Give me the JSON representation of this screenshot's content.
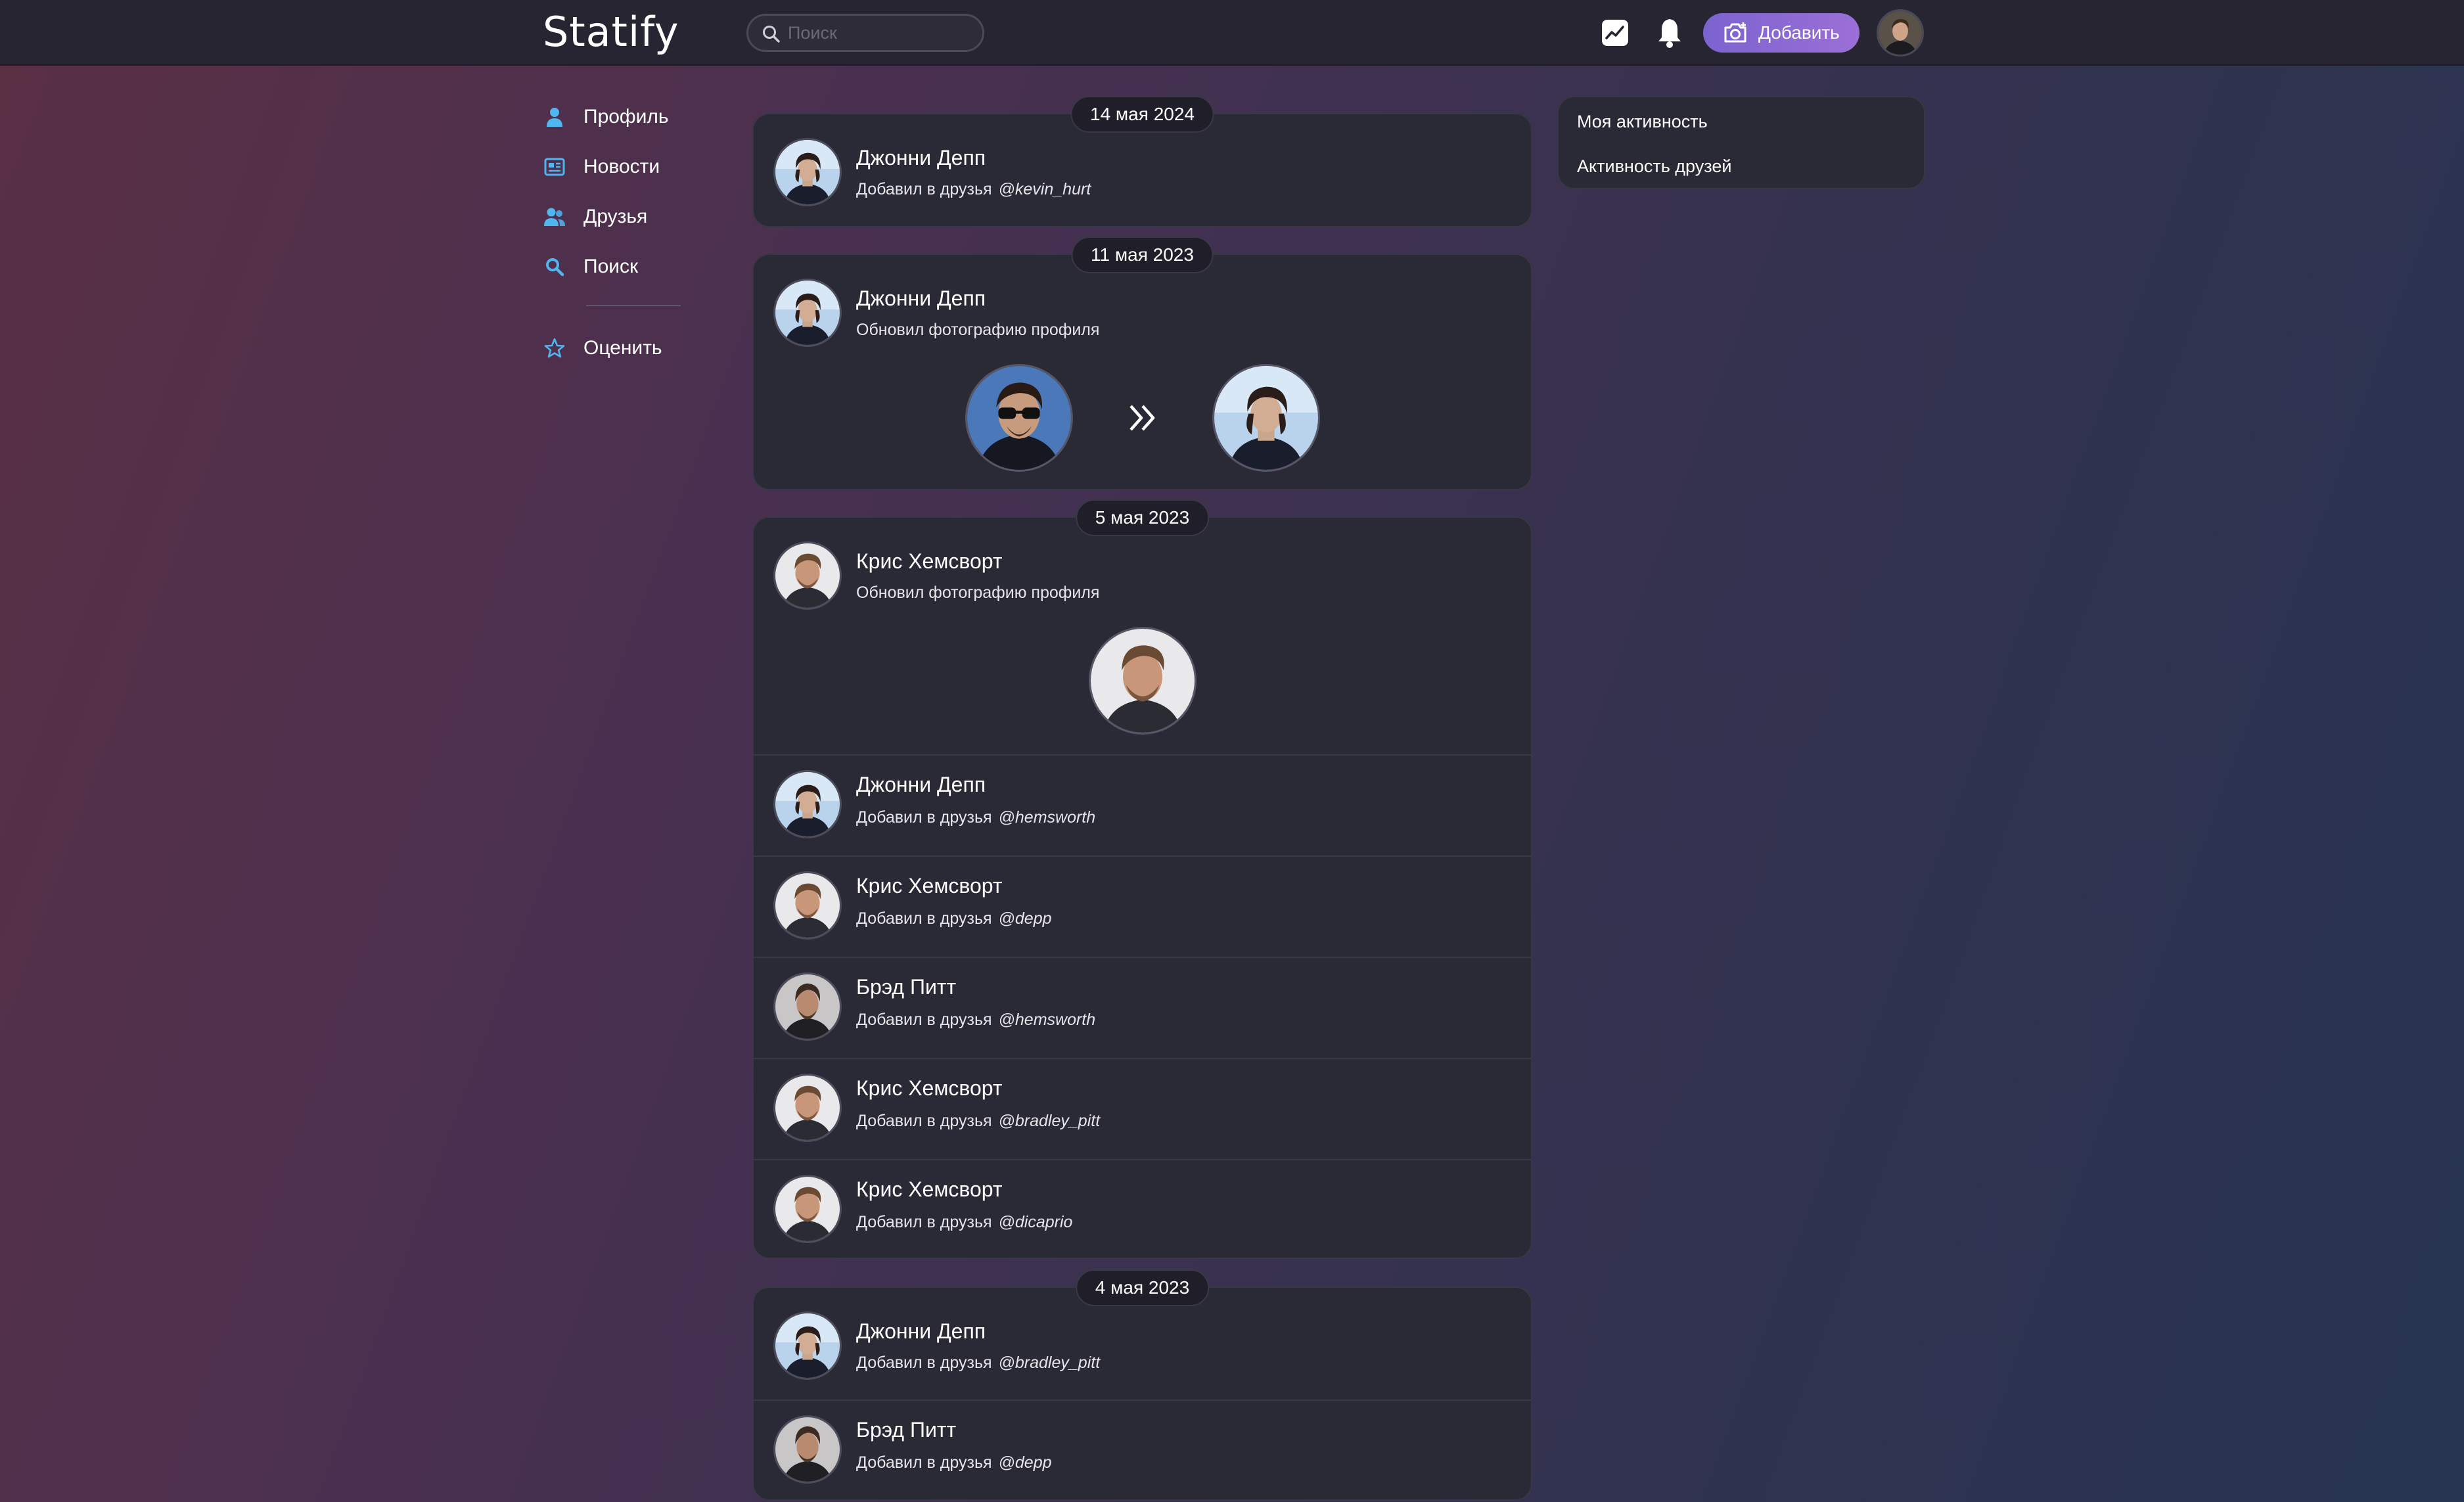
{
  "header": {
    "logo": "Statify",
    "search_placeholder": "Поиск",
    "add_button_label": "Добавить"
  },
  "sidebar": {
    "items": [
      {
        "label": "Профиль",
        "icon": "user-icon"
      },
      {
        "label": "Новости",
        "icon": "newspaper-icon"
      },
      {
        "label": "Друзья",
        "icon": "friends-icon"
      },
      {
        "label": "Поиск",
        "icon": "search-icon"
      },
      {
        "label": "Оценить",
        "icon": "star-icon"
      }
    ]
  },
  "right_panel": {
    "items": [
      "Моя активность",
      "Активность друзей"
    ]
  },
  "feed": [
    {
      "date": "14 мая 2024",
      "entries": [
        {
          "name": "Джонни Депп",
          "action": "Добавил в друзья",
          "handle": "@kevin_hurt",
          "avatar": "depp"
        }
      ]
    },
    {
      "date": "11 мая 2023",
      "entries": [
        {
          "name": "Джонни Депп",
          "action": "Обновил фотографию профиля",
          "handle": "",
          "avatar": "depp"
        }
      ]
    },
    {
      "date": "5 мая 2023",
      "entries": [
        {
          "name": "Крис Хемсворт",
          "action": "Обновил фотографию профиля",
          "handle": "",
          "avatar": "hemsworth"
        },
        {
          "name": "Джонни Депп",
          "action": "Добавил в друзья",
          "handle": "@hemsworth",
          "avatar": "depp"
        },
        {
          "name": "Крис Хемсворт",
          "action": "Добавил в друзья",
          "handle": "@depp",
          "avatar": "hemsworth"
        },
        {
          "name": "Брэд Питт",
          "action": "Добавил в друзья",
          "handle": "@hemsworth",
          "avatar": "pitt"
        },
        {
          "name": "Крис Хемсворт",
          "action": "Добавил в друзья",
          "handle": "@bradley_pitt",
          "avatar": "hemsworth"
        },
        {
          "name": "Крис Хемсворт",
          "action": "Добавил в друзья",
          "handle": "@dicaprio",
          "avatar": "hemsworth"
        }
      ]
    },
    {
      "date": "4 мая 2023",
      "entries": [
        {
          "name": "Джонни Депп",
          "action": "Добавил в друзья",
          "handle": "@bradley_pitt",
          "avatar": "depp"
        },
        {
          "name": "Брэд Питт",
          "action": "Добавил в друзья",
          "handle": "@depp",
          "avatar": "pitt"
        }
      ]
    }
  ],
  "colors": {
    "accent": "#7c63cf",
    "sidebar_icon": "#4fb6f0",
    "card_bg": "#2a2936",
    "header_bg": "#262531"
  }
}
